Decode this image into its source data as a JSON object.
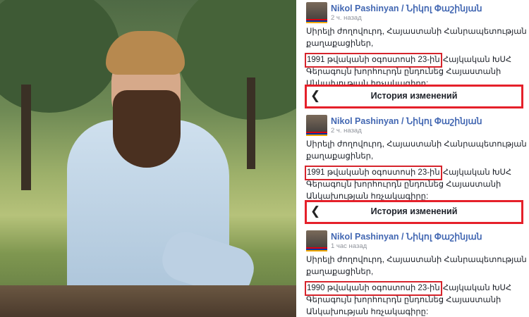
{
  "photo": {
    "alt": "Portrait of bearded man in light blue shirt leaning on a wooden railing"
  },
  "history_header": {
    "title": "История изменений"
  },
  "posts": [
    {
      "author": "Nikol Pashinyan / Նիկոլ Փաշինյան",
      "time": "2 ч. назад",
      "lines": [
        "Սիրելի ժողովուրդ, Հայաստանի Հանրապետության սիրելի",
        "քաղաքացիներ,"
      ],
      "highlight": "1991 թվականի օգոստոսի 23-ին",
      "highlight_rest": " Հայկական ԽՍՀ",
      "tail": [
        "Գերագույն խորհուրդն ընդունեց Հայաստանի",
        "Անկախության հռչակագիրը:"
      ]
    },
    {
      "author": "Nikol Pashinyan / Նիկոլ Փաշինյան",
      "time": "2 ч. назад",
      "lines": [
        "Սիրելի ժողովուրդ, Հայաստանի Հանրապետության սիրելի",
        "քաղաքացիներ,"
      ],
      "highlight": "1991 թվականի օգոստոսի 23-ին",
      "highlight_rest": " Հայկական ԽՍՀ",
      "tail": [
        "Գերագույն խորհուրդն ընդունեց Հայաստանի",
        "Անկախության հռչակագիրը:"
      ]
    },
    {
      "author": "Nikol Pashinyan / Նիկոլ Փաշինյան",
      "time": "1 час назад",
      "lines": [
        "Սիրելի ժողովուրդ, Հայաստանի Հանրապետության սիրելի",
        "քաղաքացիներ,"
      ],
      "highlight": "1990 թվականի օգոստոսի 23-ին",
      "highlight_rest": " Հայկական ԽՍՀ",
      "tail": [
        "Գերագույն խորհուրդն ընդունեց Հայաստանի",
        "Անկախության հռչակագիրը:"
      ]
    }
  ]
}
